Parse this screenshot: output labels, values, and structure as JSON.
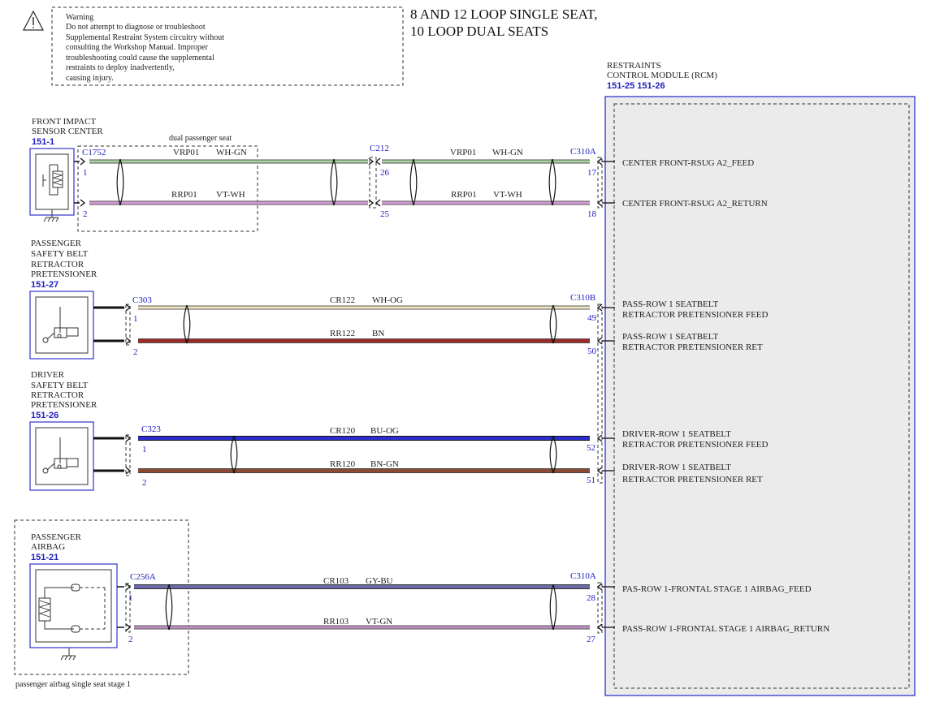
{
  "warning": {
    "lines": [
      "Warning",
      "Do not attempt to diagnose or troubleshoot",
      "Supplemental Restraint System circuitry without",
      "consulting the Workshop Manual. Improper",
      "troubleshooting could cause the supplemental",
      "restraints to deploy inadvertently,",
      "causing injury."
    ]
  },
  "title": {
    "line1": "8 AND 12 LOOP SINGLE SEAT,",
    "line2": "10 LOOP DUAL SEATS"
  },
  "rcm": {
    "name_line1": "RESTRAINTS",
    "name_line2": "CONTROL MODULE (RCM)",
    "refs": "151-25   151-26",
    "signals": {
      "s1": "CENTER FRONT-RSUG A2_FEED",
      "s2": "CENTER FRONT-RSUG A2_RETURN",
      "s3a": "PASS-ROW 1 SEATBELT",
      "s3b": "RETRACTOR PRETENSIONER FEED",
      "s4a": "PASS-ROW 1 SEATBELT",
      "s4b": "RETRACTOR PRETENSIONER RET",
      "s5a": "DRIVER-ROW 1 SEATBELT",
      "s5b": "RETRACTOR PRETENSIONER FEED",
      "s6a": "DRIVER-ROW 1 SEATBELT",
      "s6b": "RETRACTOR PRETENSIONER RET",
      "s7": "PAS-ROW 1-FRONTAL STAGE 1 AIRBAG_FEED",
      "s8": "PASS-ROW 1-FRONTAL STAGE 1 AIRBAG_RETURN"
    }
  },
  "components": {
    "fis": {
      "line1": "FRONT IMPACT",
      "line2": "SENSOR CENTER",
      "ref": "151-1"
    },
    "pass_belt": {
      "line1": "PASSENGER",
      "line2": "SAFETY BELT",
      "line3": "RETRACTOR",
      "line4": "PRETENSIONER",
      "ref": "151-27"
    },
    "drv_belt": {
      "line1": "DRIVER",
      "line2": "SAFETY BELT",
      "line3": "RETRACTOR",
      "line4": "PRETENSIONER",
      "ref": "151-26"
    },
    "pass_airbag": {
      "line1": "PASSENGER",
      "line2": "AIRBAG",
      "ref": "151-21"
    }
  },
  "notes": {
    "dual_seat": "dual passenger seat",
    "single_seat": "passenger airbag single seat stage 1"
  },
  "connectors": {
    "c1752": "C1752",
    "c212": "C212",
    "c310a_top": "C310A",
    "c303": "C303",
    "c310b": "C310B",
    "c323": "C323",
    "c256a": "C256A",
    "c310a_bottom": "C310A"
  },
  "wires": {
    "w1": {
      "circuit": "VRP01",
      "color": "WH-GN"
    },
    "w2": {
      "circuit": "RRP01",
      "color": "VT-WH"
    },
    "w3": {
      "circuit": "CR122",
      "color": "WH-OG"
    },
    "w4": {
      "circuit": "RR122",
      "color": "BN"
    },
    "w5": {
      "circuit": "CR120",
      "color": "BU-OG"
    },
    "w6": {
      "circuit": "RR120",
      "color": "BN-GN"
    },
    "w7": {
      "circuit": "CR103",
      "color": "GY-BU"
    },
    "w8": {
      "circuit": "RR103",
      "color": "VT-GN"
    }
  },
  "pins": {
    "fis_1": "1",
    "fis_2": "2",
    "c212_26": "26",
    "c212_25": "25",
    "rcm_17": "17",
    "rcm_18": "18",
    "pb_1": "1",
    "pb_2": "2",
    "rcm_49": "49",
    "rcm_50": "50",
    "db_1": "1",
    "db_2": "2",
    "rcm_52": "52",
    "rcm_51": "51",
    "ab_1": "1",
    "ab_2": "2",
    "rcm_28": "28",
    "rcm_27": "27"
  },
  "wire_colors": {
    "wh_gn": "#a9d3a0",
    "vt_wh": "#d79ad7",
    "wh_og": "#f4e6c2",
    "bn": "#9b2a2a",
    "bu_og": "#2d2dcf",
    "bn_gn": "#8b4a36",
    "gy_bu": "#6a6aa8",
    "vt_gn": "#c391c8",
    "module_fill": "#ebebeb",
    "frame_blue": "#3333cc"
  }
}
